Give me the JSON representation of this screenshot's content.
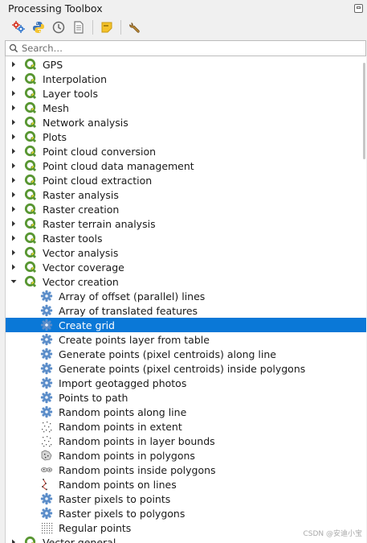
{
  "panel": {
    "title": "Processing Toolbox"
  },
  "toolbar": {
    "buttons": [
      {
        "name": "models-button",
        "icon": "models-icon"
      },
      {
        "name": "scripts-button",
        "icon": "python-icon"
      },
      {
        "name": "history-button",
        "icon": "history-icon"
      },
      {
        "name": "results-viewer-button",
        "icon": "results-icon"
      },
      {
        "name": "edit-features-in-place-button",
        "icon": "edit-in-place-icon"
      },
      {
        "name": "options-button",
        "icon": "wrench-icon"
      }
    ]
  },
  "search": {
    "placeholder": "Search…",
    "value": ""
  },
  "tree": {
    "groups": [
      {
        "label": "GPS",
        "expanded": false
      },
      {
        "label": "Interpolation",
        "expanded": false
      },
      {
        "label": "Layer tools",
        "expanded": false
      },
      {
        "label": "Mesh",
        "expanded": false
      },
      {
        "label": "Network analysis",
        "expanded": false
      },
      {
        "label": "Plots",
        "expanded": false
      },
      {
        "label": "Point cloud conversion",
        "expanded": false
      },
      {
        "label": "Point cloud data management",
        "expanded": false
      },
      {
        "label": "Point cloud extraction",
        "expanded": false
      },
      {
        "label": "Raster analysis",
        "expanded": false
      },
      {
        "label": "Raster creation",
        "expanded": false
      },
      {
        "label": "Raster terrain analysis",
        "expanded": false
      },
      {
        "label": "Raster tools",
        "expanded": false
      },
      {
        "label": "Vector analysis",
        "expanded": false
      },
      {
        "label": "Vector coverage",
        "expanded": false
      },
      {
        "label": "Vector creation",
        "expanded": true,
        "children": [
          {
            "label": "Array of offset (parallel) lines",
            "icon": "gear-icon"
          },
          {
            "label": "Array of translated features",
            "icon": "gear-icon"
          },
          {
            "label": "Create grid",
            "icon": "gear-icon",
            "selected": true
          },
          {
            "label": "Create points layer from table",
            "icon": "gear-icon"
          },
          {
            "label": "Generate points (pixel centroids) along line",
            "icon": "gear-icon"
          },
          {
            "label": "Generate points (pixel centroids) inside polygons",
            "icon": "gear-icon"
          },
          {
            "label": "Import geotagged photos",
            "icon": "gear-icon"
          },
          {
            "label": "Points to path",
            "icon": "gear-icon"
          },
          {
            "label": "Random points along line",
            "icon": "gear-icon"
          },
          {
            "label": "Random points in extent",
            "icon": "random-points-icon"
          },
          {
            "label": "Random points in layer bounds",
            "icon": "random-points-icon"
          },
          {
            "label": "Random points in polygons",
            "icon": "random-polygons-icon"
          },
          {
            "label": "Random points inside polygons",
            "icon": "random-inside-polygons-icon"
          },
          {
            "label": "Random points on lines",
            "icon": "random-lines-icon"
          },
          {
            "label": "Raster pixels to points",
            "icon": "gear-icon"
          },
          {
            "label": "Raster pixels to polygons",
            "icon": "gear-icon"
          },
          {
            "label": "Regular points",
            "icon": "regular-points-icon"
          }
        ]
      },
      {
        "label": "Vector general",
        "expanded": false
      }
    ]
  },
  "watermark": "CSDN @安迪小宝",
  "colors": {
    "selection": "#0a78d7",
    "qgis_green": "#589632",
    "gear_blue": "#5b8dc9"
  }
}
